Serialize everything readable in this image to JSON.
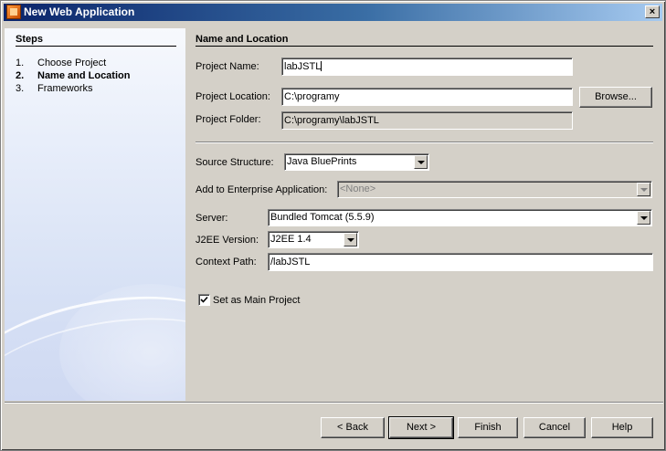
{
  "window": {
    "title": "New Web Application",
    "close_glyph": "×",
    "app_icon": "netbeans-project-icon"
  },
  "steps": {
    "heading": "Steps",
    "items": [
      {
        "number": "1.",
        "label": "Choose Project",
        "active": false
      },
      {
        "number": "2.",
        "label": "Name and Location",
        "active": true
      },
      {
        "number": "3.",
        "label": "Frameworks",
        "active": false
      }
    ]
  },
  "form": {
    "heading": "Name and Location",
    "project_name": {
      "label": "Project Name:",
      "value": "labJSTL"
    },
    "project_location": {
      "label": "Project Location:",
      "value": "C:\\programy",
      "browse_label": "Browse..."
    },
    "project_folder": {
      "label": "Project Folder:",
      "value": "C:\\programy\\labJSTL"
    },
    "source_structure": {
      "label": "Source Structure:",
      "value": "Java BluePrints"
    },
    "enterprise_app": {
      "label": "Add to Enterprise Application:",
      "value": "<None>"
    },
    "server": {
      "label": "Server:",
      "value": "Bundled Tomcat (5.5.9)"
    },
    "j2ee_version": {
      "label": "J2EE Version:",
      "value": "J2EE 1.4"
    },
    "context_path": {
      "label": "Context Path:",
      "value": "/labJSTL"
    },
    "main_project": {
      "label": "Set as Main Project",
      "checked": true
    }
  },
  "buttons": {
    "back": "< Back",
    "next": "Next >",
    "finish": "Finish",
    "cancel": "Cancel",
    "help": "Help"
  }
}
